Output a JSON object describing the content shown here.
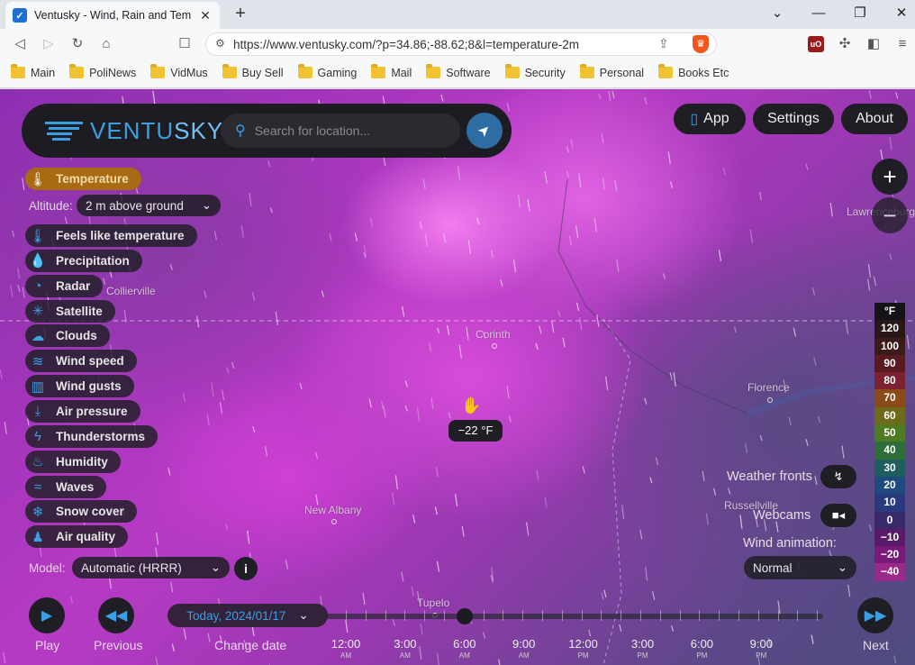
{
  "browser": {
    "tab_title": "Ventusky - Wind, Rain and Temperature Maps",
    "url": "https://www.ventusky.com/?p=34.86;-88.62;8&l=temperature-2m",
    "bookmarks": [
      "Main",
      "PoliNews",
      "VidMus",
      "Buy Sell",
      "Gaming",
      "Mail",
      "Software",
      "Security",
      "Personal",
      "Books Etc"
    ]
  },
  "header": {
    "logo_a": "VENTU",
    "logo_b": "SKY",
    "search_placeholder": "Search for location...",
    "app_label": "App",
    "settings_label": "Settings",
    "about_label": "About"
  },
  "layers": {
    "active": "Temperature",
    "altitude_label": "Altitude:",
    "altitude_value": "2 m above ground",
    "items": [
      "Feels like temperature",
      "Precipitation",
      "Radar",
      "Satellite",
      "Clouds",
      "Wind speed",
      "Wind gusts",
      "Air pressure",
      "Thunderstorms",
      "Humidity",
      "Waves",
      "Snow cover",
      "Air quality"
    ],
    "model_label": "Model:",
    "model_value": "Automatic (HRRR)"
  },
  "map": {
    "cities": [
      "Corinth",
      "Florence",
      "New Albany",
      "Tupelo",
      "Russellville",
      "Collierville",
      "Lawrenceburg"
    ],
    "tooltip": "−22 °F"
  },
  "scale": {
    "unit": "°F",
    "values": [
      "120",
      "100",
      "90",
      "80",
      "70",
      "60",
      "50",
      "40",
      "30",
      "20",
      "10",
      "0",
      "−10",
      "−20",
      "−40"
    ],
    "colors": [
      "#2a1818",
      "#3b1a1a",
      "#5a1a22",
      "#7a2230",
      "#8a4a1a",
      "#6e6a1a",
      "#4e7a22",
      "#2e6e3a",
      "#1e5e5e",
      "#1e4a7e",
      "#2a3a7e",
      "#3a2a6a",
      "#5a1a6a",
      "#7a1a7a",
      "#9a2a8a"
    ]
  },
  "right": {
    "weather_fronts": "Weather fronts",
    "webcams": "Webcams",
    "wind_animation_label": "Wind animation:",
    "wind_animation_value": "Normal"
  },
  "bottom": {
    "play": "Play",
    "previous": "Previous",
    "change_date": "Change date",
    "date": "Today, 2024/01/17",
    "next": "Next",
    "times": [
      {
        "t": "12:00",
        "ap": "AM"
      },
      {
        "t": "3:00",
        "ap": "AM"
      },
      {
        "t": "6:00",
        "ap": "AM"
      },
      {
        "t": "9:00",
        "ap": "AM"
      },
      {
        "t": "12:00",
        "ap": "PM"
      },
      {
        "t": "3:00",
        "ap": "PM"
      },
      {
        "t": "6:00",
        "ap": "PM"
      },
      {
        "t": "9:00",
        "ap": "PM"
      }
    ]
  }
}
